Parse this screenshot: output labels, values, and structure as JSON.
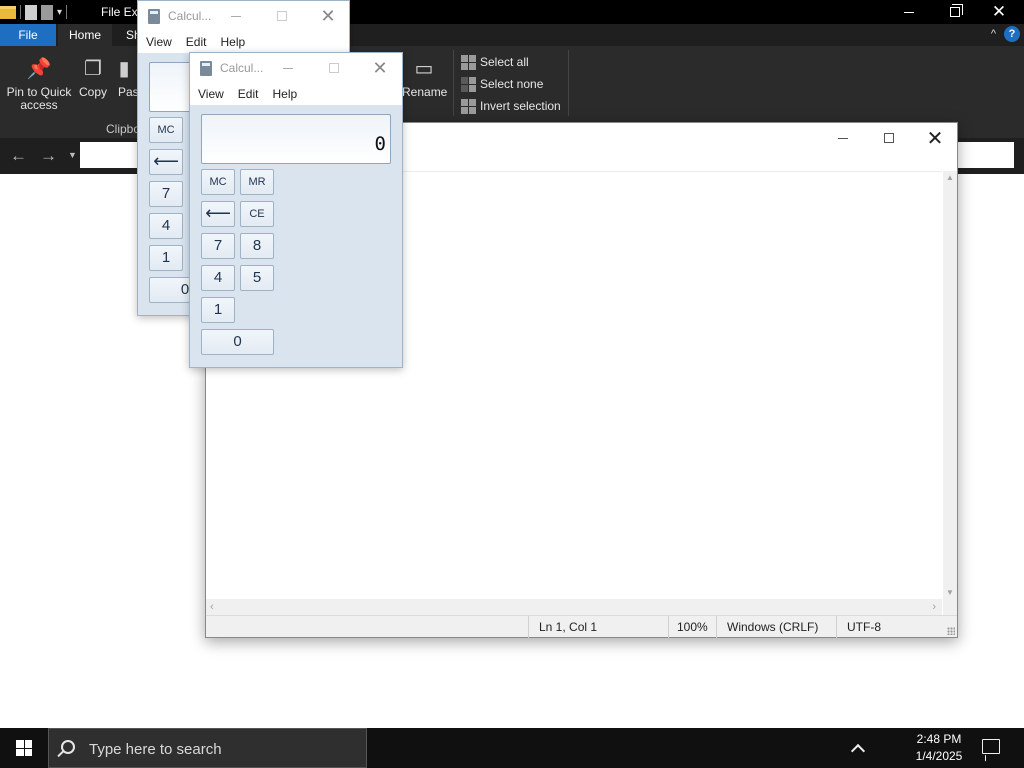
{
  "explorer": {
    "title": "File Exp",
    "tabs": {
      "file": "File",
      "home": "Home",
      "share": "Sh"
    },
    "ribbon": {
      "pin_label": "Pin to Quick access",
      "copy_label": "Copy",
      "paste_label": "Pas",
      "clipboard_group": "Clipbo",
      "rename_label": "Rename",
      "select_all": "Select all",
      "select_none": "Select none",
      "invert_selection": "Invert selection"
    },
    "help_glyph": "?"
  },
  "notepad": {
    "status": {
      "position": "Ln 1, Col 1",
      "zoom": "100%",
      "line_ending": "Windows (CRLF)",
      "encoding": "UTF-8"
    }
  },
  "calculator_back": {
    "title": "Calcul...",
    "menu": {
      "view": "View",
      "edit": "Edit",
      "help": "Help"
    },
    "buttons": {
      "mc": "MC",
      "back": "⟵",
      "seven": "7",
      "four": "4",
      "one": "1",
      "zero": "0"
    }
  },
  "calculator_front": {
    "title": "Calcul...",
    "menu": {
      "view": "View",
      "edit": "Edit",
      "help": "Help"
    },
    "display": "0",
    "buttons": {
      "mc": "MC",
      "mr": "MR",
      "back": "⟵",
      "ce": "CE",
      "seven": "7",
      "eight": "8",
      "four": "4",
      "five": "5",
      "one": "1",
      "zero": "0"
    }
  },
  "taskbar": {
    "search_placeholder": "Type here to search",
    "time": "2:48 PM",
    "date": "1/4/2025"
  },
  "icons": {
    "start": "windows-logo-icon",
    "search": "search-icon",
    "tray": "chevron-up-icon",
    "notifications": "notification-icon"
  },
  "colors": {
    "file_tab_accent": "#1e6fc2",
    "explorer_dark": "#1f1f1f",
    "calculator_body": "#d9e4ef",
    "taskbar": "#101010"
  }
}
